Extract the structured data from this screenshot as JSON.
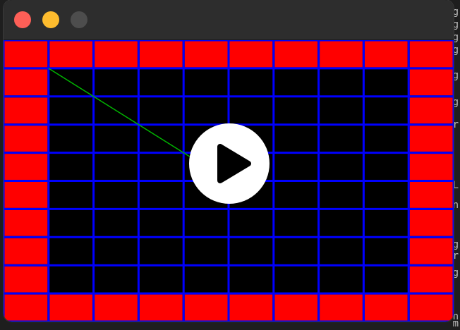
{
  "window": {
    "traffic_lights": {
      "close_color": "#fe5f57",
      "minimize_color": "#febc2e",
      "zoom_color": "#4d4d4d"
    }
  },
  "canvas": {
    "grid_columns": 10,
    "grid_rows": 10,
    "wall_color": "#ff0000",
    "floor_color": "#000000",
    "grid_line_color": "#0000ff",
    "path_color": "#00b400"
  },
  "player": {
    "icon": "play-icon",
    "background": "#ffffff",
    "icon_color": "#000000"
  },
  "background_terminal": {
    "glyphs": [
      "g",
      "g",
      "g",
      "g",
      "g",
      "g",
      "r",
      "L",
      "n",
      "g",
      "r",
      "g",
      "n",
      "m"
    ]
  }
}
